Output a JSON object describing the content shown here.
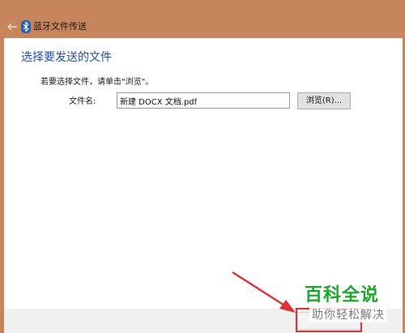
{
  "window": {
    "title": "蓝牙文件传送",
    "icons": {
      "back": "back-arrow-icon",
      "app": "bluetooth-icon"
    }
  },
  "main": {
    "heading": "选择要发送的文件",
    "instruction": "若要选择文件，请单击\"浏览\"。",
    "file_label": "文件名:",
    "file_value": "新建 DOCX 文档.pdf",
    "browse_label": "浏览(R)..."
  },
  "watermark": {
    "logo": "百科全说",
    "subtitle": "助你轻松解决"
  },
  "colors": {
    "titlebar": "#c6855a",
    "heading": "#1f4fb5",
    "annotation": "#e53030",
    "logo": "#1aa82a"
  }
}
